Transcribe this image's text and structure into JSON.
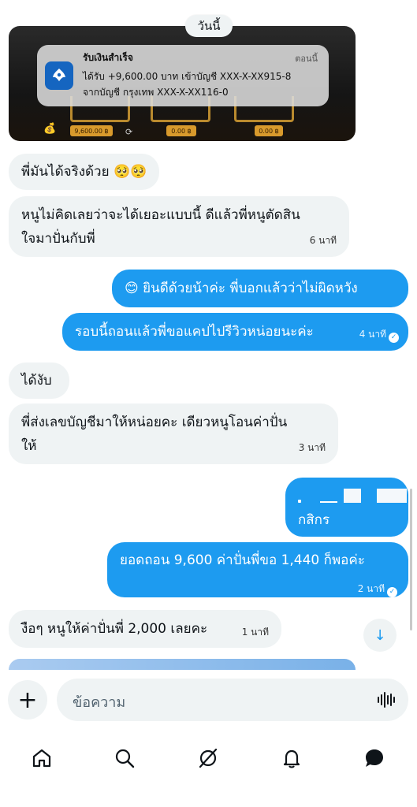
{
  "date_pill": "วันนี้",
  "notification": {
    "title": "รับเงินสำเร็จ",
    "time": "ตอนนี้",
    "line1": "ได้รับ +9,600.00 บาท เข้าบัญชี XXX-X-XX915-8",
    "line2": "จากบัญชี กรุงเทพ XXX-X-XX116-0",
    "chips": [
      "9,600.00 ฿",
      "0.00 ฿",
      "0.00 ฿"
    ]
  },
  "messages": [
    {
      "dir": "in",
      "text": "พี่มันได้จริงด้วย 🥺🥺",
      "time": ""
    },
    {
      "dir": "in",
      "line1": "หนูไม่คิดเลยว่าจะได้เยอะแบบนี้ ดีแล้วพี่หนูตัดสิน",
      "line2": "ใจมาปั่นกับพี่",
      "time": "6 นาที"
    },
    {
      "dir": "out",
      "text": "😊 ยินดีด้วยน้าค่ะ พี่บอกแล้วว่าไม่ผิดหวัง",
      "time": ""
    },
    {
      "dir": "out",
      "text": "รอบนี้ถอนแล้วพี่ขอแคปไปรีวิวหน่อยนะค่ะ",
      "time": "4 นาที"
    },
    {
      "dir": "in",
      "text": "ได้งับ",
      "time": ""
    },
    {
      "dir": "in",
      "line1": "พี่ส่งเลขบัญชีมาให้หน่อยคะ เดียวหนูโอนค่าปั่น",
      "line2": "ให้",
      "time": "3 นาที"
    },
    {
      "dir": "out",
      "text": "กสิกร",
      "time": ""
    },
    {
      "dir": "out",
      "text": "ยอดถอน 9,600 ค่าปั่นพี่ขอ 1,440 ก็พอค่ะ",
      "time": "2 นาที"
    },
    {
      "dir": "in",
      "text": "งือๆ หนูให้ค่าปั่นพี่ 2,000 เลยคะ",
      "time": "1 นาที"
    }
  ],
  "composer": {
    "placeholder": "ข้อความ"
  },
  "nav": [
    "home-icon",
    "search-icon",
    "grok-icon",
    "bell-icon",
    "messages-icon"
  ],
  "colors": {
    "accent": "#1d9bf0",
    "incoming_bg": "#eff3f4"
  }
}
